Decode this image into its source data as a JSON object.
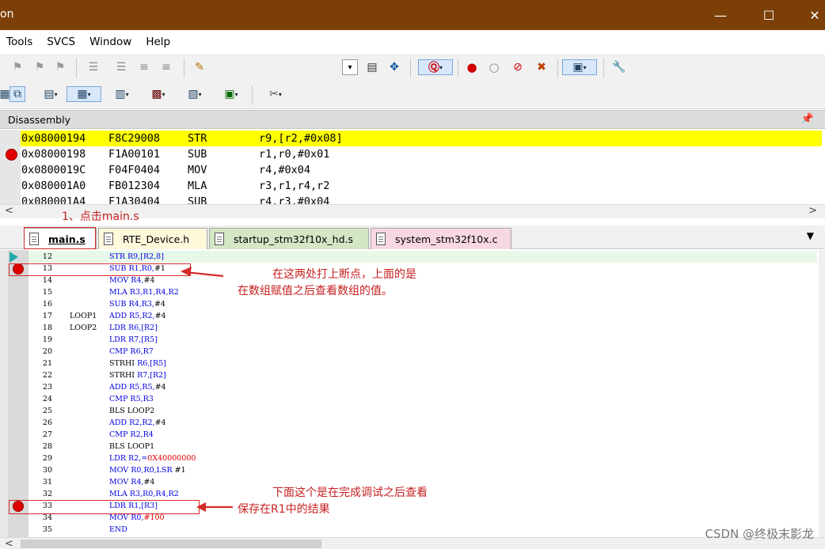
{
  "window": {
    "title": "on",
    "minimize": "—",
    "maximize": "☐",
    "close": "✕"
  },
  "menu": [
    "Tools",
    "SVCS",
    "Window",
    "Help"
  ],
  "disassembly": {
    "title": "Disassembly",
    "pin": "ᐩ",
    "lines": [
      {
        "addr": "0x08000194",
        "opcode": "F8C29008",
        "mnemonic": "STR",
        "operands": "r9,[r2,#0x08]"
      },
      {
        "addr": "0x08000198",
        "opcode": "F1A00101",
        "mnemonic": "SUB",
        "operands": "r1,r0,#0x01"
      },
      {
        "addr": "0x0800019C",
        "opcode": "F04F0404",
        "mnemonic": "MOV",
        "operands": "r4,#0x04"
      },
      {
        "addr": "0x080001A0",
        "opcode": "FB012304",
        "mnemonic": "MLA",
        "operands": "r3,r1,r4,r2"
      },
      {
        "addr": "0x080001A4",
        "opcode": "F1A30404",
        "mnemonic": "SUB",
        "operands": "r4,r3,#0x04"
      }
    ]
  },
  "tabs": [
    {
      "label": "main.s",
      "bg": "#ffffff"
    },
    {
      "label": "RTE_Device.h",
      "bg": "#fff9dc"
    },
    {
      "label": "startup_stm32f10x_hd.s",
      "bg": "#d4e6c4"
    },
    {
      "label": "system_stm32f10x.c",
      "bg": "#f8d8e0"
    }
  ],
  "editor_lines": [
    {
      "n": "12",
      "label": "",
      "parts": [
        [
          "STR ",
          "kw"
        ],
        [
          "R9,[R2,8]",
          "kw"
        ]
      ]
    },
    {
      "n": "13",
      "label": "",
      "parts": [
        [
          "SUB ",
          "kw"
        ],
        [
          "R1,R0,",
          "kw"
        ],
        [
          "#1",
          "k"
        ]
      ]
    },
    {
      "n": "14",
      "label": "",
      "parts": [
        [
          "MOV ",
          "kw"
        ],
        [
          "R4,",
          "kw"
        ],
        [
          "#4",
          "k"
        ]
      ]
    },
    {
      "n": "15",
      "label": "",
      "parts": [
        [
          "MLA ",
          "kw"
        ],
        [
          "R3,R1,R4,R2",
          "kw"
        ]
      ]
    },
    {
      "n": "16",
      "label": "",
      "parts": [
        [
          "SUB ",
          "kw"
        ],
        [
          "R4,R3,",
          "kw"
        ],
        [
          "#4",
          "k"
        ]
      ]
    },
    {
      "n": "17",
      "label": "LOOP1",
      "parts": [
        [
          "ADD ",
          "kw"
        ],
        [
          "R5,R2,",
          "kw"
        ],
        [
          "#4",
          "k"
        ]
      ]
    },
    {
      "n": "18",
      "label": "LOOP2",
      "parts": [
        [
          "LDR ",
          "kw"
        ],
        [
          "R6,[R2]",
          "kw"
        ]
      ]
    },
    {
      "n": "19",
      "label": "",
      "parts": [
        [
          "LDR ",
          "kw"
        ],
        [
          "R7,[R5]",
          "kw"
        ]
      ]
    },
    {
      "n": "20",
      "label": "",
      "parts": [
        [
          "CMP ",
          "kw"
        ],
        [
          "R6,R7",
          "kw"
        ]
      ]
    },
    {
      "n": "21",
      "label": "",
      "parts": [
        [
          "STRHI ",
          "k"
        ],
        [
          "R6,[R5]",
          "kw"
        ]
      ]
    },
    {
      "n": "22",
      "label": "",
      "parts": [
        [
          "STRHI ",
          "k"
        ],
        [
          "R7,[R2]",
          "kw"
        ]
      ]
    },
    {
      "n": "23",
      "label": "",
      "parts": [
        [
          "ADD ",
          "kw"
        ],
        [
          "R5,R5,",
          "kw"
        ],
        [
          "#4",
          "k"
        ]
      ]
    },
    {
      "n": "24",
      "label": "",
      "parts": [
        [
          "CMP ",
          "kw"
        ],
        [
          "R5,R3",
          "kw"
        ]
      ]
    },
    {
      "n": "25",
      "label": "",
      "parts": [
        [
          "BLS ",
          "k"
        ],
        [
          "LOOP2",
          "k"
        ]
      ]
    },
    {
      "n": "26",
      "label": "",
      "parts": [
        [
          "ADD ",
          "kw"
        ],
        [
          "R2,R2,",
          "kw"
        ],
        [
          "#4",
          "k"
        ]
      ]
    },
    {
      "n": "27",
      "label": "",
      "parts": [
        [
          "CMP ",
          "kw"
        ],
        [
          "R2,R4",
          "kw"
        ]
      ]
    },
    {
      "n": "28",
      "label": "",
      "parts": [
        [
          "BLS ",
          "k"
        ],
        [
          "LOOP1",
          "k"
        ]
      ]
    },
    {
      "n": "29",
      "label": "",
      "parts": [
        [
          "LDR ",
          "kw"
        ],
        [
          "R2,=",
          "kw"
        ],
        [
          "0X40000000",
          "num"
        ]
      ]
    },
    {
      "n": "30",
      "label": "",
      "parts": [
        [
          "MOV ",
          "kw"
        ],
        [
          "R0,R0,",
          "kw"
        ],
        [
          "LSR ",
          "kw"
        ],
        [
          "#1",
          "k"
        ]
      ]
    },
    {
      "n": "31",
      "label": "",
      "parts": [
        [
          "MOV ",
          "kw"
        ],
        [
          "R4,",
          "kw"
        ],
        [
          "#4",
          "k"
        ]
      ]
    },
    {
      "n": "32",
      "label": "",
      "parts": [
        [
          "MLA ",
          "kw"
        ],
        [
          "R3,R0,R4,R2",
          "kw"
        ]
      ]
    },
    {
      "n": "33",
      "label": "",
      "parts": [
        [
          "LDR ",
          "kw"
        ],
        [
          "R1,[R3]",
          "kw"
        ]
      ]
    },
    {
      "n": "34",
      "label": "",
      "parts": [
        [
          "MOV ",
          "kw"
        ],
        [
          "R0,",
          "kw"
        ],
        [
          "#100",
          "num"
        ]
      ]
    },
    {
      "n": "35",
      "label": "",
      "parts": [
        [
          "END",
          "kw"
        ]
      ]
    }
  ],
  "annotations": {
    "step1": "1、点击main.s",
    "top_line1": "在这两处打上断点，上面的是",
    "top_line2": "在数组赋值之后查看数组的值。",
    "bottom_line1": "下面这个是在完成调试之后查看",
    "bottom_line2": "保存在R1中的结果"
  },
  "watermark": "CSDN @终极末影龙",
  "colors": {
    "titlebar": "#7b3f07",
    "current_line": "#ffff00",
    "breakpoint": "#e00000",
    "annotation": "#c62020",
    "code_blue": "#0000e0",
    "immediate_red": "#e00000"
  }
}
